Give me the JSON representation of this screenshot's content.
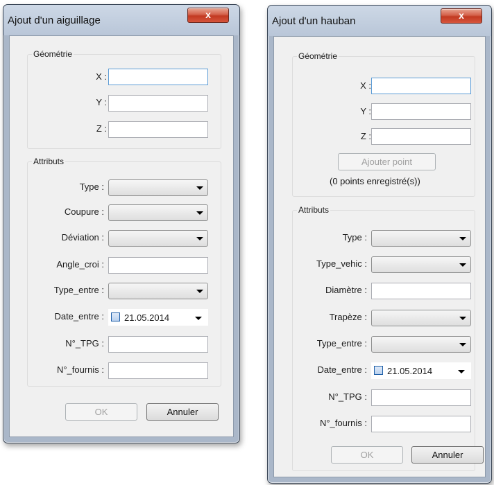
{
  "dialog1": {
    "title": "Ajout d'un aiguillage",
    "close_label": "x",
    "geometry": {
      "legend": "Géométrie",
      "fields": [
        {
          "label": "X :",
          "value": ""
        },
        {
          "label": "Y :",
          "value": ""
        },
        {
          "label": "Z :",
          "value": ""
        }
      ]
    },
    "attributes": {
      "legend": "Attributs",
      "fields": [
        {
          "label": "Type :",
          "kind": "combo",
          "value": ""
        },
        {
          "label": "Coupure :",
          "kind": "combo",
          "value": ""
        },
        {
          "label": "Déviation :",
          "kind": "combo",
          "value": ""
        },
        {
          "label": "Angle_croi :",
          "kind": "text",
          "value": ""
        },
        {
          "label": "Type_entre :",
          "kind": "combo",
          "value": ""
        },
        {
          "label": "Date_entre :",
          "kind": "date",
          "value": "21.05.2014"
        },
        {
          "label": "N°_TPG :",
          "kind": "text",
          "value": ""
        },
        {
          "label": "N°_fournis :",
          "kind": "text",
          "value": ""
        }
      ]
    },
    "ok_label": "OK",
    "cancel_label": "Annuler"
  },
  "dialog2": {
    "title": "Ajout d'un hauban",
    "close_label": "x",
    "geometry": {
      "legend": "Géométrie",
      "fields": [
        {
          "label": "X :",
          "value": ""
        },
        {
          "label": "Y :",
          "value": ""
        },
        {
          "label": "Z :",
          "value": ""
        }
      ],
      "add_point_label": "Ajouter point",
      "points_note": "(0 points enregistré(s))"
    },
    "attributes": {
      "legend": "Attributs",
      "fields": [
        {
          "label": "Type :",
          "kind": "combo",
          "value": ""
        },
        {
          "label": "Type_vehic :",
          "kind": "combo",
          "value": ""
        },
        {
          "label": "Diamètre :",
          "kind": "text",
          "value": ""
        },
        {
          "label": "Trapèze :",
          "kind": "combo",
          "value": ""
        },
        {
          "label": "Type_entre :",
          "kind": "combo",
          "value": ""
        },
        {
          "label": "Date_entre :",
          "kind": "date",
          "value": "21.05.2014"
        },
        {
          "label": "N°_TPG :",
          "kind": "text",
          "value": ""
        },
        {
          "label": "N°_fournis :",
          "kind": "text",
          "value": ""
        }
      ]
    },
    "ok_label": "OK",
    "cancel_label": "Annuler"
  }
}
